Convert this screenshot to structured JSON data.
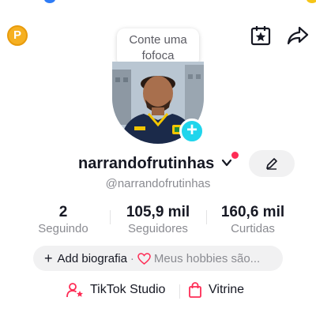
{
  "header": {
    "coin_letter": "P",
    "icons": [
      "coin-icon",
      "calendar-star-icon",
      "share-icon"
    ]
  },
  "bubble": {
    "text_line1": "Conte uma",
    "text_line2": "fofoca"
  },
  "profile": {
    "username": "narrandofrutinhas",
    "handle": "@narrandofrutinhas",
    "add_badge": "+"
  },
  "stats": [
    {
      "value": "2",
      "label": "Seguindo"
    },
    {
      "value": "105,9 mil",
      "label": "Seguidores"
    },
    {
      "value": "160,6 mil",
      "label": "Curtidas"
    }
  ],
  "bio": {
    "plus": "+",
    "add_label": "Add biografia",
    "separator": "·",
    "hobbies_label": "Meus hobbies são..."
  },
  "links": [
    {
      "label": "TikTok Studio",
      "icon": "person-star-icon"
    },
    {
      "label": "Vitrine",
      "icon": "shopping-bag-icon"
    }
  ],
  "colors": {
    "accent": "#fe2c55",
    "teal": "#20d5ec",
    "coin": "#f6b021"
  }
}
